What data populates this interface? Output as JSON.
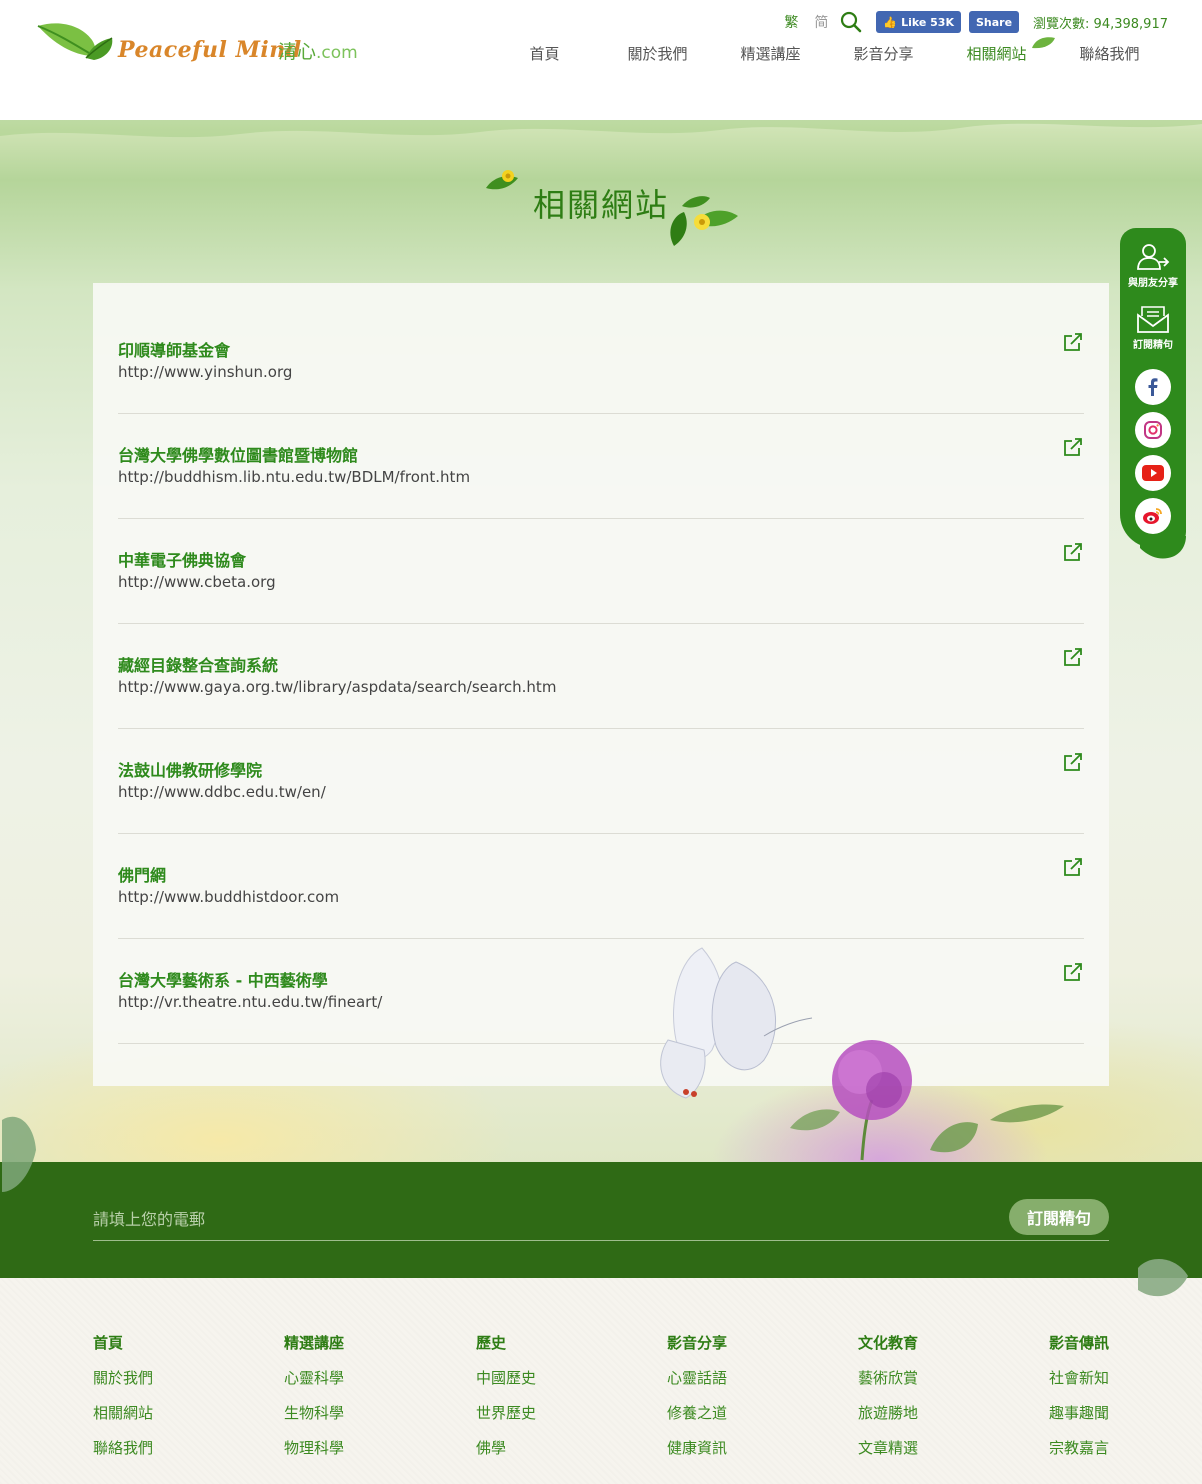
{
  "header": {
    "logo_en": "Peaceful Mind",
    "logo_zh": "清心",
    "logo_com": ".com",
    "lang_traditional": "繁",
    "lang_simplified": "简",
    "fb_like_label": "Like 53K",
    "fb_share_label": "Share",
    "views_label": "瀏覽次數: 94,398,917",
    "nav": [
      {
        "label": "首頁"
      },
      {
        "label": "關於我們"
      },
      {
        "label": "精選講座"
      },
      {
        "label": "影音分享"
      },
      {
        "label": "相關網站"
      },
      {
        "label": "聯絡我們"
      }
    ]
  },
  "page": {
    "title": "相關網站"
  },
  "links": [
    {
      "title": "印順導師基金會",
      "url": "http://www.yinshun.org"
    },
    {
      "title": "台灣大學佛學數位圖書館暨博物館",
      "url": "http://buddhism.lib.ntu.edu.tw/BDLM/front.htm"
    },
    {
      "title": "中華電子佛典協會",
      "url": "http://www.cbeta.org"
    },
    {
      "title": "藏經目錄整合查詢系統",
      "url": "http://www.gaya.org.tw/library/aspdata/search/search.htm"
    },
    {
      "title": "法鼓山佛教研修學院",
      "url": "http://www.ddbc.edu.tw/en/"
    },
    {
      "title": "佛門網",
      "url": "http://www.buddhistdoor.com"
    },
    {
      "title": "台灣大學藝術系 - 中西藝術學",
      "url": "http://vr.theatre.ntu.edu.tw/fineart/"
    }
  ],
  "side": {
    "share_label": "與朋友分享",
    "subscribe_label": "訂閱精句"
  },
  "subscribe": {
    "placeholder": "請填上您的電郵",
    "button": "訂閱精句"
  },
  "footer": {
    "columns": [
      {
        "head": "首頁",
        "links": [
          "關於我們",
          "相關網站",
          "聯絡我們"
        ]
      },
      {
        "head": "精選講座",
        "links": [
          "心靈科學",
          "生物科學",
          "物理科學"
        ]
      },
      {
        "head": "歷史",
        "links": [
          "中國歷史",
          "世界歷史",
          "佛學"
        ]
      },
      {
        "head": "影音分享",
        "links": [
          "心靈話語",
          "修養之道",
          "健康資訊"
        ]
      },
      {
        "head": "文化教育",
        "links": [
          "藝術欣賞",
          "旅遊勝地",
          "文章精選"
        ]
      },
      {
        "head": "影音傳訊",
        "links": [
          "社會新知",
          "趣事趣聞",
          "宗教嘉言"
        ]
      }
    ]
  },
  "colors": {
    "brand_green": "#2e8a1c",
    "dark_green": "#2f6a15",
    "logo_orange": "#d9862a",
    "facebook_blue": "#4267b2"
  }
}
